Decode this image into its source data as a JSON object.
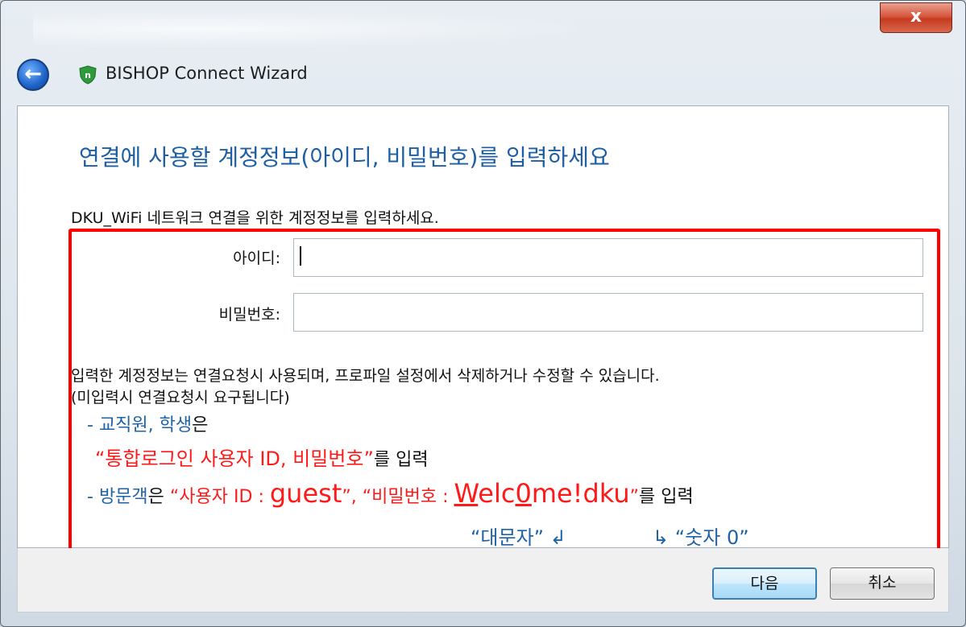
{
  "window": {
    "title": "BISHOP Connect Wizard",
    "close_label": "x"
  },
  "page": {
    "heading": "연결에 사용할 계정정보(아이디, 비밀번호)를 입력하세요",
    "intro": "DKU_WiFi 네트워크 연결을 위한 계정정보를 입력하세요."
  },
  "form": {
    "id_label": "아이디:",
    "id_value": "",
    "password_label": "비밀번호:",
    "password_value": ""
  },
  "info": {
    "line1": "입력한 계정정보는 연결요청시 사용되며, 프로파일 설정에서 삭제하거나 수정할 수 있습니다.",
    "line2": "(미입력시 연결요청시 요구됩니다)"
  },
  "annotation": {
    "dash1": "- ",
    "staff_students": "교직원, 학생",
    "eun1": "은",
    "integrated_login": "“통합로그인 사용자 ID, 비밀번호”",
    "reul_input1": "를 입력",
    "dash2": "- ",
    "visitor": "방문객",
    "eun2": "은 ",
    "user_id_prefix": "“사용자 ID : ",
    "guest": "guest",
    "user_id_suffix": "”, ",
    "pw_prefix": "“비밀번호   : ",
    "pw_W": "W",
    "pw_mid": "elc",
    "pw_zero": "0",
    "pw_end": "me!dku",
    "pw_close": "”",
    "reul_input2": "를 입력",
    "uppercase_note": "“대문자”",
    "arrow_left": "↲",
    "arrow_right": "↳",
    "digit_note": "“숫자 0”"
  },
  "buttons": {
    "next": "다음",
    "cancel": "취소"
  },
  "colors": {
    "heading_blue": "#1e5fa3",
    "annotation_red": "#ff0000",
    "annotation_blue": "#1e63a6"
  }
}
